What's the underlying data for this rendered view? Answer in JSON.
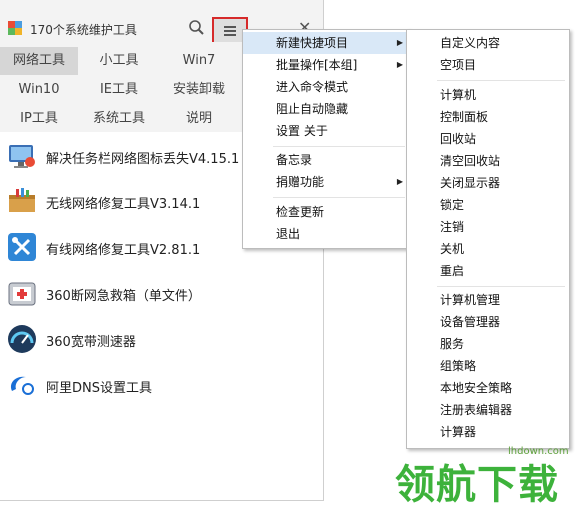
{
  "app": {
    "title": "170个系统维护工具"
  },
  "tabs": [
    {
      "label": "网络工具",
      "active": true
    },
    {
      "label": "小工具"
    },
    {
      "label": "Win7"
    },
    {
      "label": "Win10"
    },
    {
      "label": "IE工具"
    },
    {
      "label": "安装卸载"
    },
    {
      "label": "IP工具"
    },
    {
      "label": "系统工具"
    },
    {
      "label": "说明"
    }
  ],
  "tools": [
    {
      "label": "解决任务栏网络图标丢失V4.15.1",
      "icon": "network-monitor-icon"
    },
    {
      "label": "无线网络修复工具V3.14.1",
      "icon": "toolbox-icon"
    },
    {
      "label": "有线网络修复工具V2.81.1",
      "icon": "tools-icon"
    },
    {
      "label": "360断网急救箱（单文件）",
      "icon": "first-aid-icon"
    },
    {
      "label": "360宽带测速器",
      "icon": "speedometer-icon"
    },
    {
      "label": "阿里DNS设置工具",
      "icon": "ali-logo-icon"
    }
  ],
  "menu": {
    "items": [
      {
        "label": "新建快捷项目",
        "submenu": true,
        "highlighted": true
      },
      {
        "label": "批量操作[本组]",
        "submenu": true
      },
      {
        "label": "进入命令模式"
      },
      {
        "label": "阻止自动隐藏"
      },
      {
        "label": "设置 关于"
      },
      {
        "label": "备忘录"
      },
      {
        "label": "捐赠功能",
        "submenu": true
      },
      {
        "label": "检查更新"
      },
      {
        "label": "退出"
      }
    ]
  },
  "submenu": {
    "items": [
      "自定义内容",
      "空项目",
      "计算机",
      "控制面板",
      "回收站",
      "清空回收站",
      "关闭显示器",
      "锁定",
      "注销",
      "关机",
      "重启",
      "计算机管理",
      "设备管理器",
      "服务",
      "组策略",
      "本地安全策略",
      "注册表编辑器",
      "计算器"
    ]
  },
  "watermark": {
    "text": "领航下载",
    "url": "lhdown.com"
  },
  "colors": {
    "highlight_border": "#d62a2a",
    "menu_highlight": "#d9e8f7",
    "watermark": "#3db23b"
  }
}
